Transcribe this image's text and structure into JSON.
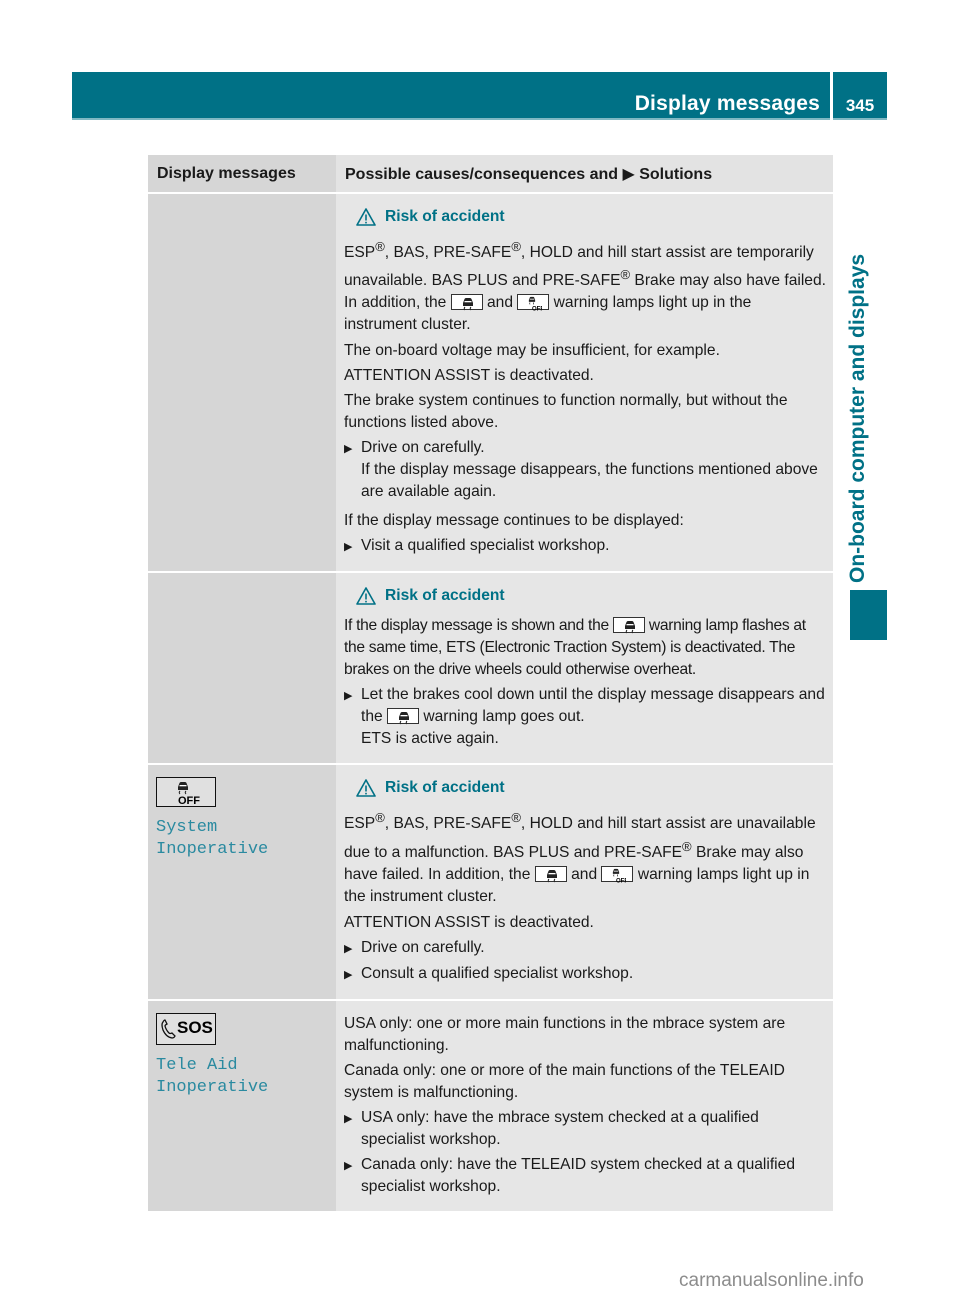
{
  "header": {
    "section_title": "Display messages",
    "page_number": "345",
    "chapter_side_label": "On-board computer and displays"
  },
  "table": {
    "columns": [
      "Display messages",
      "Possible causes/consequences and ▶ Solutions"
    ],
    "rows": [
      {
        "display": null,
        "warning_title": "Risk of accident",
        "paragraphs": [
          [
            "ESP",
            "®",
            ", BAS, PRE-SAFE",
            "®",
            ", HOLD and hill start assist are temporarily unavailable. BAS PLUS and PRE-SAFE",
            "®",
            " Brake may also have failed. In addition, the ",
            "[skid-lamp]",
            " and ",
            "[esp-off-lamp]",
            " warning lamps light up in the instrument cluster."
          ],
          "The on-board voltage may be insufficient, for example.",
          "ATTENTION ASSIST is deactivated.",
          "The brake system continues to function normally, but without the functions listed above."
        ],
        "steps_a": [
          {
            "text": "Drive on carefully.",
            "sub": "If the display message disappears, the functions mentioned above are available again."
          }
        ],
        "mid_text": "If the display message continues to be displayed:",
        "steps_b": [
          "Visit a qualified specialist workshop."
        ]
      },
      {
        "display": null,
        "warning_title": "Risk of accident",
        "para_pre": "If the display message is shown and the",
        "para_post": "warning lamp flashes at the same time, ETS (Electronic Traction System) is deactivated. The brakes on the drive wheels could otherwise overheat.",
        "step_pre": "Let the brakes cool down until the display message disappears and the",
        "step_post": "warning lamp goes out.",
        "step_sub": "ETS is active again."
      },
      {
        "display_icon": "esp-off-icon",
        "display_text": "System Inoperative",
        "warning_title": "Risk of accident",
        "para1_a": "ESP",
        "para1_b": ", BAS, PRE-SAFE",
        "para1_c": ", HOLD and hill start assist are unavailable due to a malfunction. BAS PLUS and PRE-SAFE",
        "para1_d": " Brake may also have failed. In addition, the",
        "para1_e": "and",
        "para1_f": "warning lamps light up in the instrument cluster.",
        "para2": "ATTENTION ASSIST is deactivated.",
        "steps": [
          "Drive on carefully.",
          "Consult a qualified specialist workshop."
        ]
      },
      {
        "display_icon": "sos-phone-icon",
        "display_icon_text": "SOS",
        "display_text_line1": "Tele Aid",
        "display_text_line2": "Inoperative",
        "para1": "USA only: one or more main functions in the mbrace system are malfunctioning.",
        "para2": "Canada only: one or more of the main functions of the TELEAID system is malfunctioning.",
        "steps": [
          "USA only: have the mbrace system checked at a qualified specialist workshop.",
          "Canada only: have the TELEAID system checked at a qualified specialist workshop."
        ]
      }
    ]
  },
  "symbols": {
    "registered": "®",
    "arrow": "▶",
    "off_label": "OFF"
  },
  "watermark": "carmanualsonline.info",
  "colors": {
    "brand_teal": "#007186",
    "display_text": "#2a8aa0"
  }
}
